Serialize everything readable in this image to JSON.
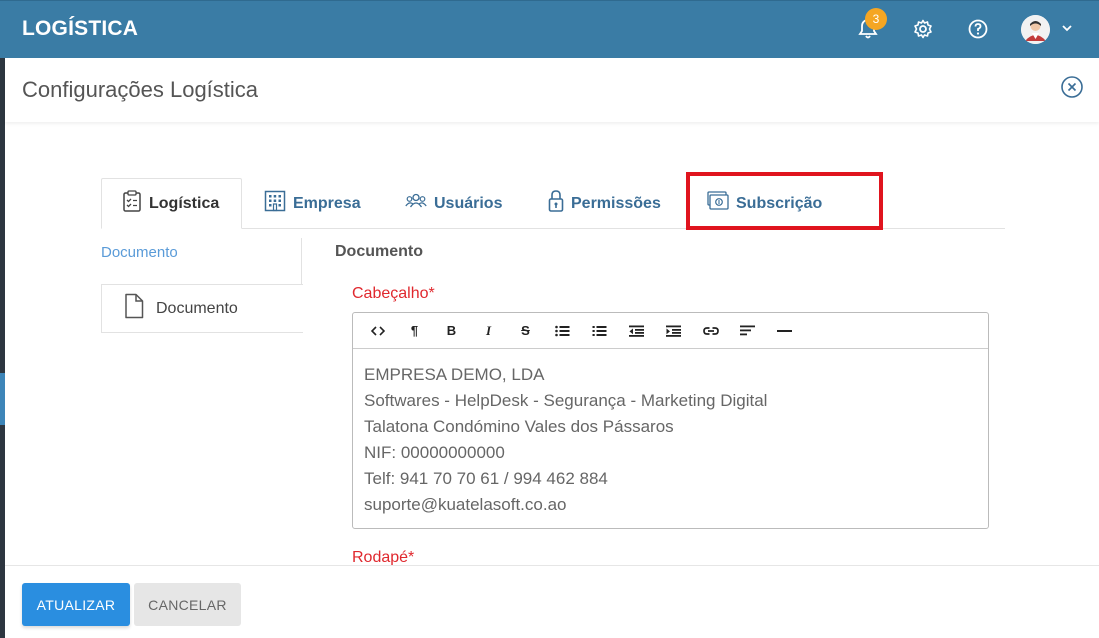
{
  "app": {
    "title": "LOGÍSTICA"
  },
  "topbar": {
    "notifications_count": "3",
    "icons": [
      "bell-icon",
      "gear-icon",
      "help-icon",
      "avatar",
      "chevron-down-icon"
    ]
  },
  "dialog": {
    "title": "Configurações Logística"
  },
  "tabs": [
    {
      "label": "Logística",
      "icon": "checklist-icon",
      "active": true
    },
    {
      "label": "Empresa",
      "icon": "building-icon",
      "active": false
    },
    {
      "label": "Usuários",
      "icon": "users-icon",
      "active": false
    },
    {
      "label": "Permissões",
      "icon": "lock-icon",
      "active": false
    },
    {
      "label": "Subscrição",
      "icon": "money-icon",
      "active": false,
      "highlighted": true
    }
  ],
  "subnav": {
    "header": "Documento",
    "items": [
      {
        "label": "Documento",
        "icon": "file-icon"
      }
    ]
  },
  "form": {
    "section_title": "Documento",
    "header_label": "Cabeçalho*",
    "footer_label": "Rodapé*",
    "header_lines": [
      "EMPRESA DEMO, LDA",
      "Softwares - HelpDesk - Segurança - Marketing Digital",
      "Talatona Condómino Vales dos Pássaros",
      "NIF: 00000000000",
      "Telf: 941 70 70 61 / 994 462 884",
      "suporte@kuatelasoft.co.ao"
    ],
    "toolbar_buttons": [
      {
        "name": "code-view",
        "glyph": "<>"
      },
      {
        "name": "paragraph",
        "glyph": "¶"
      },
      {
        "name": "bold",
        "glyph": "B"
      },
      {
        "name": "italic",
        "glyph": "I"
      },
      {
        "name": "strikethrough",
        "glyph": "S"
      },
      {
        "name": "unordered-list",
        "glyph": ""
      },
      {
        "name": "ordered-list",
        "glyph": ""
      },
      {
        "name": "outdent",
        "glyph": ""
      },
      {
        "name": "indent",
        "glyph": ""
      },
      {
        "name": "link",
        "glyph": ""
      },
      {
        "name": "align-left",
        "glyph": ""
      },
      {
        "name": "horizontal-rule",
        "glyph": ""
      }
    ]
  },
  "footer": {
    "update_label": "ATUALIZAR",
    "cancel_label": "CANCELAR"
  },
  "colors": {
    "topbar": "#3a7ca5",
    "tab_text": "#3a6d96",
    "required_label": "#e0282e",
    "primary_button": "#2a8ee0",
    "badge": "#f5a623",
    "highlight": "#e0141e"
  }
}
